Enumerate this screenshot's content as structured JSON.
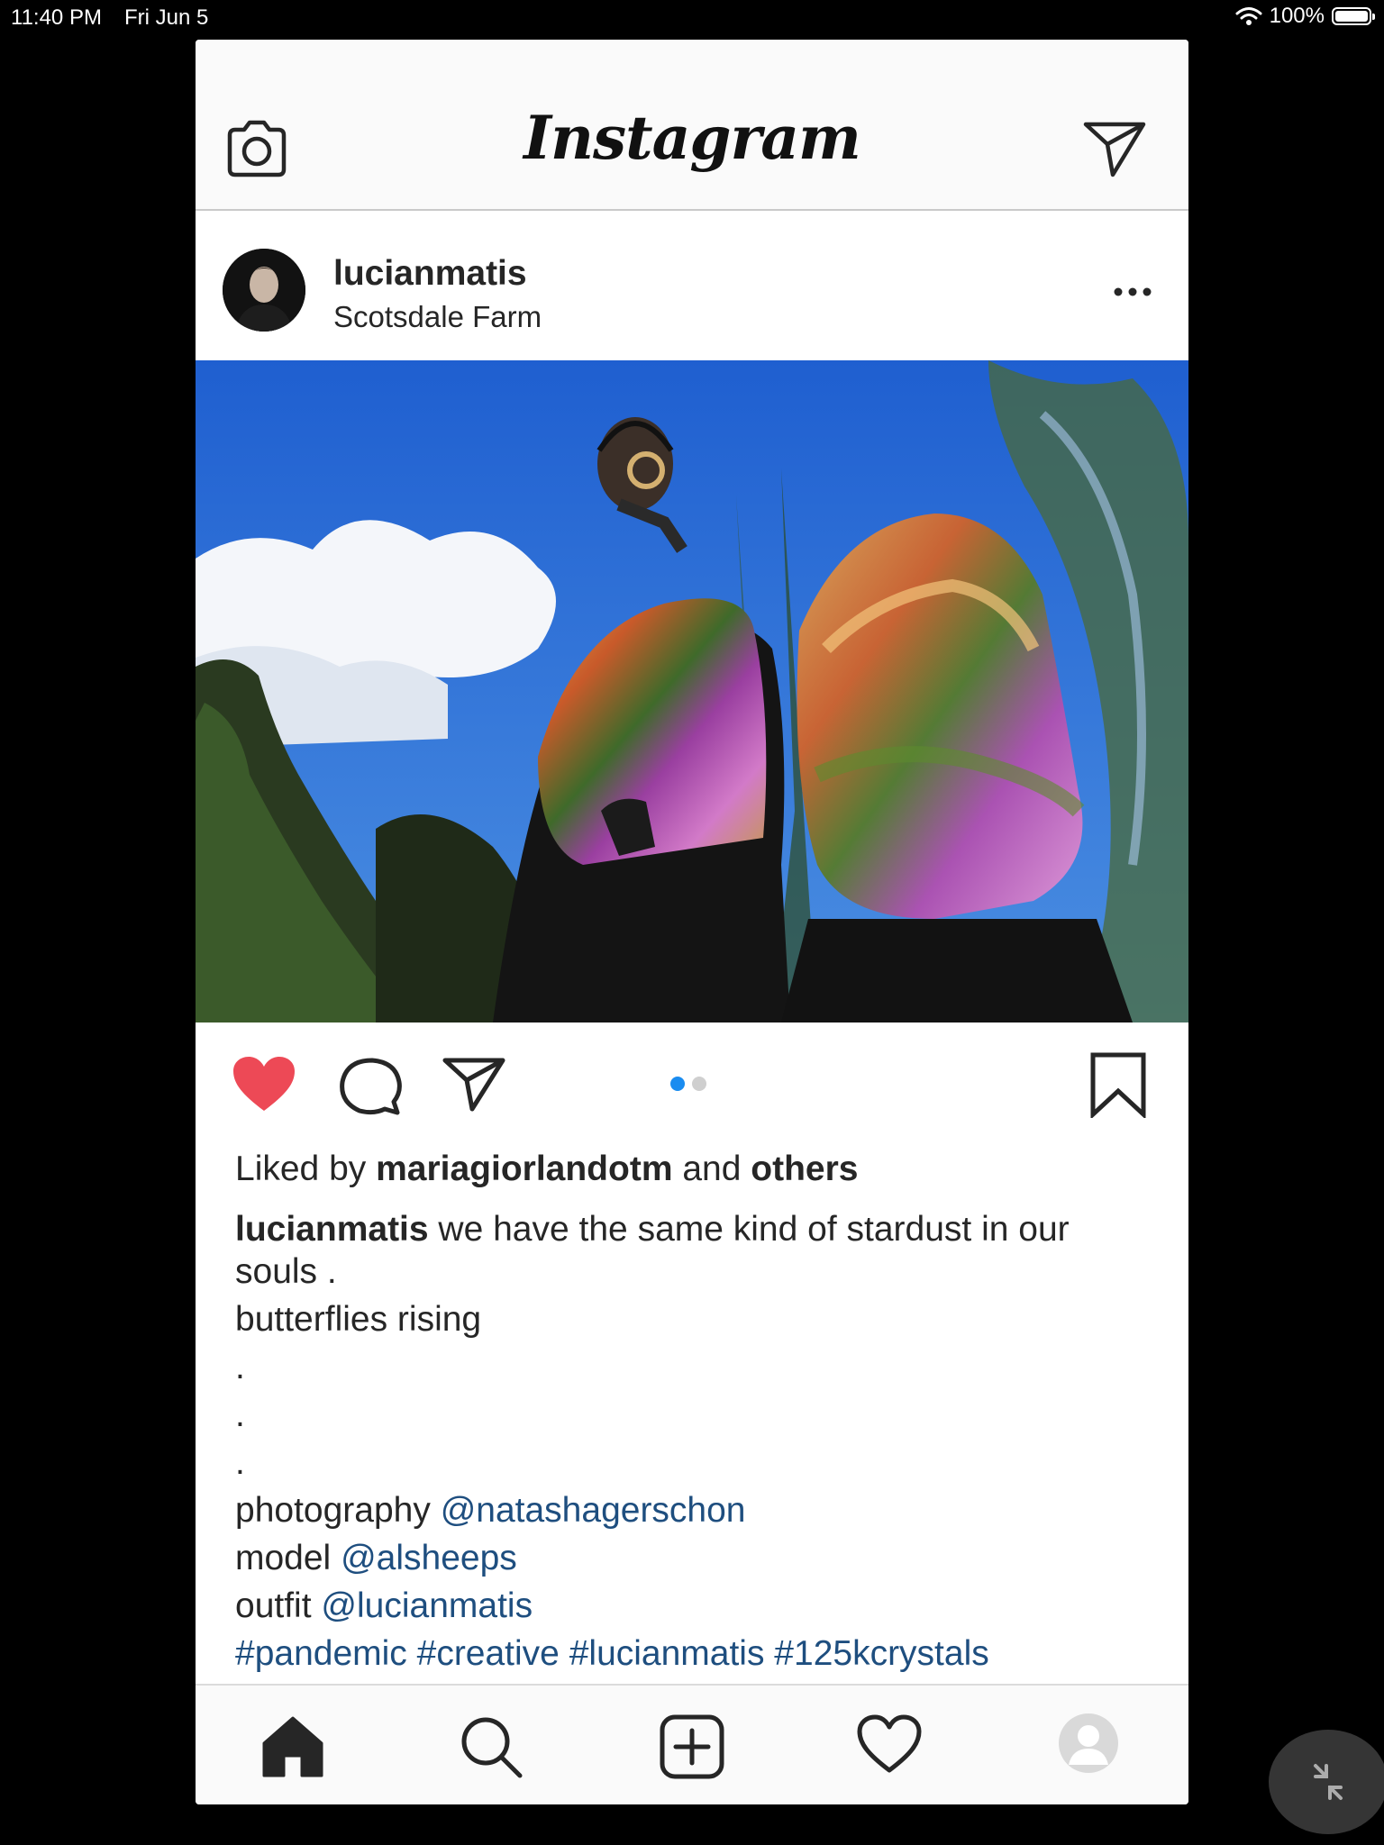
{
  "status_bar": {
    "time": "11:40 PM",
    "date": "Fri Jun 5",
    "battery": "100%",
    "battery_level": 1.0
  },
  "app": {
    "logo": "Instagram"
  },
  "post": {
    "username": "lucianmatis",
    "location": "Scotsdale Farm",
    "liked_by_prefix": "Liked by",
    "liked_by_user": "mariagiorlandotm",
    "liked_by_and": "and",
    "liked_by_others": "others",
    "caption_username": "lucianmatis",
    "caption_lines": [
      "we have the same kind of stardust in our",
      "souls .",
      "butterflies rising",
      ".",
      ".",
      "."
    ],
    "credits": [
      {
        "label": "photography",
        "handle": "@natashagerschon"
      },
      {
        "label": "model",
        "handle": "@alsheeps"
      },
      {
        "label": "outfit",
        "handle": "@lucianmatis"
      }
    ],
    "hashtags": "#pandemic #creative #lucianmatis #125kcrystals",
    "carousel_pages": 2,
    "carousel_current": 1,
    "liked": true
  },
  "icons": [
    "camera-icon",
    "direct-message-icon",
    "more-options-icon",
    "heart-icon",
    "comment-icon",
    "share-icon",
    "bookmark-icon",
    "home-icon",
    "search-icon",
    "new-post-icon",
    "activity-icon",
    "profile-icon",
    "exit-fullscreen-icon"
  ],
  "colors": {
    "like_red": "#ed4956",
    "link_blue": "#1e4e7f",
    "dot_active": "#1a8cf0"
  }
}
